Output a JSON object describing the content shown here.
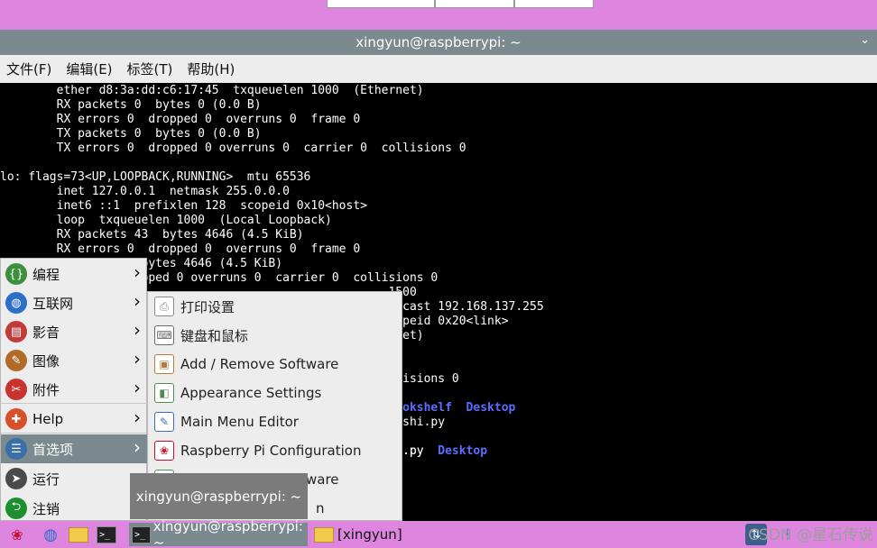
{
  "window": {
    "title": "xingyun@raspberrypi: ~"
  },
  "menubar": [
    "文件(F)",
    "编辑(E)",
    "标签(T)",
    "帮助(H)"
  ],
  "terminal": {
    "lines": [
      {
        "text": "        ether d8:3a:dd:c6:17:45  txqueuelen 1000  (Ethernet)"
      },
      {
        "text": "        RX packets 0  bytes 0 (0.0 B)"
      },
      {
        "text": "        RX errors 0  dropped 0  overruns 0  frame 0"
      },
      {
        "text": "        TX packets 0  bytes 0 (0.0 B)"
      },
      {
        "text": "        TX errors 0  dropped 0 overruns 0  carrier 0  collisions 0"
      },
      {
        "text": ""
      },
      {
        "text": "lo: flags=73<UP,LOOPBACK,RUNNING>  mtu 65536"
      },
      {
        "text": "        inet 127.0.0.1  netmask 255.0.0.0"
      },
      {
        "text": "        inet6 ::1  prefixlen 128  scopeid 0x10<host>"
      },
      {
        "text": "        loop  txqueuelen 1000  (Local Loopback)"
      },
      {
        "text": "        RX packets 43  bytes 4646 (4.5 KiB)"
      },
      {
        "text": "        RX errors 0  dropped 0  overruns 0  frame 0"
      },
      {
        "text": "                 3  bytes 4646 (4.5 KiB)"
      },
      {
        "text": "                 dropped 0 overruns 0  carrier 0  collisions 0"
      },
      {
        "text": "                                                       1500"
      },
      {
        "text": "                                                       adcast 192.168.137.255"
      },
      {
        "text": "                                                       copeid 0x20<link>"
      },
      {
        "text": "                                                       rnet)"
      },
      {
        "text": ""
      },
      {
        "text": ""
      },
      {
        "text": "                                                       llisions 0"
      },
      {
        "text": ""
      },
      {
        "text": ""
      },
      {
        "text": "                                                       ceshi.py"
      },
      {
        "text": ""
      },
      {
        "text": "                                                       hi.py  "
      }
    ],
    "highlights": [
      {
        "row": 22,
        "prefix": "                                                       ",
        "text": "Bookshelf  Desktop"
      },
      {
        "row": 25,
        "prefix": "                                                       hi.py  ",
        "text": "Desktop"
      }
    ]
  },
  "start_menu": {
    "items": [
      {
        "label": "编程",
        "icon": "programming-icon",
        "color": "#3c8f3c",
        "glyph": "{}",
        "submenu": true
      },
      {
        "label": "互联网",
        "icon": "internet-globe-icon",
        "color": "#2d6fc7",
        "glyph": "◍",
        "submenu": true
      },
      {
        "label": "影音",
        "icon": "sound-video-icon",
        "color": "#c23b3b",
        "glyph": "▤",
        "submenu": true
      },
      {
        "label": "图像",
        "icon": "graphics-brush-icon",
        "color": "#b06a2a",
        "glyph": "✎",
        "submenu": true
      },
      {
        "label": "附件",
        "icon": "accessories-knife-icon",
        "color": "#c8322f",
        "glyph": "✂",
        "submenu": true
      },
      {
        "label": "Help",
        "icon": "help-lifebuoy-icon",
        "color": "#d8502a",
        "glyph": "✚",
        "submenu": true
      },
      {
        "label": "首选项",
        "icon": "preferences-icon",
        "color": "#3a6fa8",
        "glyph": "☰",
        "submenu": true,
        "active": true
      },
      {
        "label": "运行",
        "icon": "run-icon",
        "color": "#4a4a4a",
        "glyph": "➤",
        "submenu": false
      },
      {
        "label": "注销",
        "icon": "logout-icon",
        "color": "#1e8f2f",
        "glyph": "⮌",
        "submenu": false
      }
    ]
  },
  "submenu": {
    "items": [
      {
        "label": "打印设置",
        "icon": "printer-icon",
        "color": "#8a8a8a",
        "glyph": "⎙"
      },
      {
        "label": "键盘和鼠标",
        "icon": "keyboard-mouse-icon",
        "color": "#6b6b6b",
        "glyph": "⌨"
      },
      {
        "label": "Add / Remove Software",
        "icon": "package-box-icon",
        "color": "#b07d3a",
        "glyph": "▣"
      },
      {
        "label": "Appearance Settings",
        "icon": "appearance-icon",
        "color": "#4f8a4f",
        "glyph": "◧"
      },
      {
        "label": "Main Menu Editor",
        "icon": "menu-editor-icon",
        "color": "#3f6fb5",
        "glyph": "✎"
      },
      {
        "label": "Raspberry Pi Configuration",
        "icon": "raspberry-icon",
        "color": "#c8102e",
        "glyph": "❀"
      },
      {
        "label": "ware",
        "icon": "raspberry-green-icon",
        "color": "#4e9a4e",
        "glyph": "❀"
      },
      {
        "label": "n",
        "icon": "",
        "color": "transparent",
        "glyph": ""
      }
    ]
  },
  "tooltip": {
    "text": "xingyun@raspberrypi: ~"
  },
  "taskbar": {
    "tasks": [
      {
        "label": "xingyun@raspberrypi: ~",
        "icon": "terminal-icon",
        "active": true
      },
      {
        "label": "[xingyun]",
        "icon": "folder-icon",
        "active": false
      }
    ],
    "watermark": "CSDN @星石传说"
  }
}
